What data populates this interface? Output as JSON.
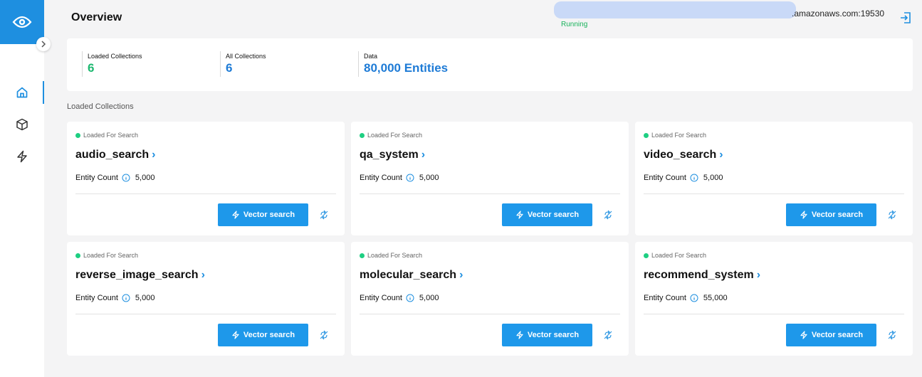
{
  "header": {
    "title": "Overview",
    "host": ".amazonaws.com:19530",
    "status": "Running"
  },
  "stats": [
    {
      "label": "Loaded Collections",
      "value": "6"
    },
    {
      "label": "All Collections",
      "value": "6"
    },
    {
      "label": "Data",
      "value": "80,000 Entities"
    }
  ],
  "section_label": "Loaded Collections",
  "collections": [
    {
      "status": "Loaded For Search",
      "name": "audio_search",
      "entity_label": "Entity Count",
      "entity_count": "5,000",
      "button": "Vector search"
    },
    {
      "status": "Loaded For Search",
      "name": "qa_system",
      "entity_label": "Entity Count",
      "entity_count": "5,000",
      "button": "Vector search"
    },
    {
      "status": "Loaded For Search",
      "name": "video_search",
      "entity_label": "Entity Count",
      "entity_count": "5,000",
      "button": "Vector search"
    },
    {
      "status": "Loaded For Search",
      "name": "reverse_image_search",
      "entity_label": "Entity Count",
      "entity_count": "5,000",
      "button": "Vector search"
    },
    {
      "status": "Loaded For Search",
      "name": "molecular_search",
      "entity_label": "Entity Count",
      "entity_count": "5,000",
      "button": "Vector search"
    },
    {
      "status": "Loaded For Search",
      "name": "recommend_system",
      "entity_label": "Entity Count",
      "entity_count": "55,000",
      "button": "Vector search"
    }
  ],
  "sidebar": {
    "items": [
      {
        "icon": "home-icon",
        "active": true
      },
      {
        "icon": "cube-icon",
        "active": false
      },
      {
        "icon": "lightning-icon",
        "active": false
      }
    ]
  },
  "colors": {
    "accent": "#1e8fe0",
    "button": "#1e98ea",
    "loaded_green": "#1ecf82",
    "running_green": "#18b25b"
  }
}
